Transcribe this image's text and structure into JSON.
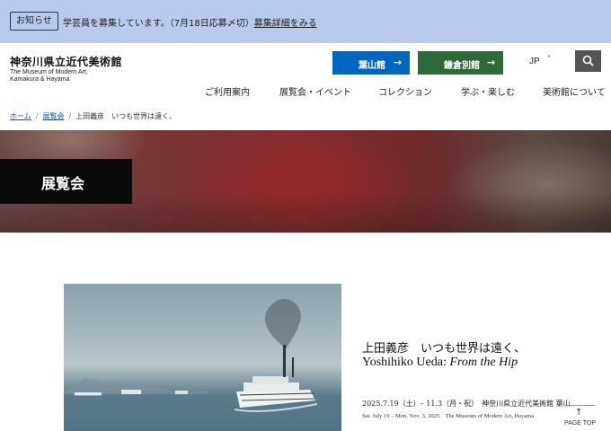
{
  "notice": {
    "badge": "お知らせ",
    "text": "学芸員を募集しています。（7月18日応募〆切）",
    "link": "募集詳細をみる"
  },
  "header": {
    "logo_jp": "神奈川県立近代美術館",
    "logo_en_line1": "The Museum of Modern Art,",
    "logo_en_line2": "Kamakura & Hayama",
    "btn_hayama": "葉山館",
    "btn_kamakura": "鎌倉別館",
    "btn_arrow": "→",
    "lang": "JP",
    "lang_chevron": "˅",
    "search_icon": "search-icon",
    "colors": {
      "hayama": "#0067c0",
      "kamakura": "#2d6a3a",
      "notice_bg": "#b9caef"
    }
  },
  "nav": [
    "ご利用案内",
    "展覧会・イベント",
    "コレクション",
    "学ぶ・楽しむ",
    "美術館について"
  ],
  "breadcrumb": {
    "home": "ホーム",
    "exhibitions": "展覧会",
    "current": "上田義彦　いつも世界は遠く、",
    "sep": "/"
  },
  "hero": {
    "title": "展覧会"
  },
  "exhibition": {
    "title_jp": "上田義彦　いつも世界は遠く、",
    "title_en_name": "Yoshihiko Ueda: ",
    "title_en_sub": "From the Hip",
    "date_jp": "2025.7.19（土）– 11.3（月・祝）　神奈川県立近代美術館 葉山",
    "date_en": "Sat. July 19 – Mon. Nov. 3, 2025　The Museum of Modern Art, Hayama"
  },
  "page_top": {
    "arrow": "↑",
    "label": "PAGE TOP"
  }
}
